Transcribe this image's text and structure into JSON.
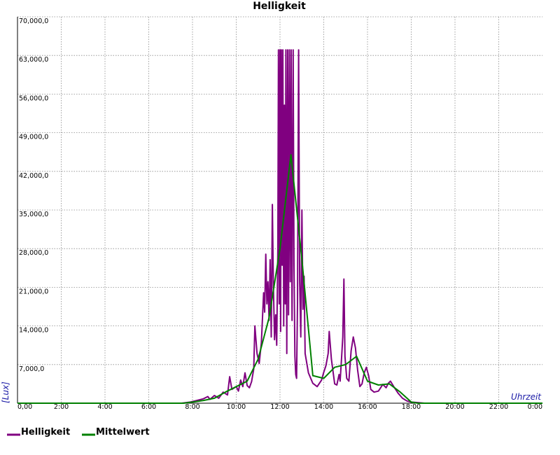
{
  "chart_data": {
    "type": "line",
    "title": "Helligkeit",
    "xlabel": "Uhrzeit",
    "ylabel": "[Lux]",
    "xlim": [
      0,
      24
    ],
    "ylim": [
      0,
      70000
    ],
    "grid": true,
    "legend_position": "bottom-left",
    "x_ticks": [
      {
        "value": 0,
        "label": "0,00"
      },
      {
        "value": 2,
        "label": "2:00"
      },
      {
        "value": 4,
        "label": "4:00"
      },
      {
        "value": 6,
        "label": "6:00"
      },
      {
        "value": 8,
        "label": "8:00"
      },
      {
        "value": 10,
        "label": "10:00"
      },
      {
        "value": 12,
        "label": "12:00"
      },
      {
        "value": 14,
        "label": "14:00"
      },
      {
        "value": 16,
        "label": "16:00"
      },
      {
        "value": 18,
        "label": "18:00"
      },
      {
        "value": 20,
        "label": "20:00"
      },
      {
        "value": 22,
        "label": "22:00"
      },
      {
        "value": 24,
        "label": "0:00"
      }
    ],
    "y_ticks": [
      {
        "value": 7000,
        "label": "7,000,0"
      },
      {
        "value": 14000,
        "label": "14,000,0"
      },
      {
        "value": 21000,
        "label": "21,000,0"
      },
      {
        "value": 28000,
        "label": "28,000,0"
      },
      {
        "value": 35000,
        "label": "35,000,0"
      },
      {
        "value": 42000,
        "label": "42,000,0"
      },
      {
        "value": 49000,
        "label": "49,000,0"
      },
      {
        "value": 56000,
        "label": "56,000,0"
      },
      {
        "value": 63000,
        "label": "63,000,0"
      },
      {
        "value": 70000,
        "label": "70,000,0"
      }
    ],
    "series": [
      {
        "name": "Helligkeit",
        "color": "#800080",
        "points": [
          [
            0,
            0
          ],
          [
            7.5,
            0
          ],
          [
            7.9,
            200
          ],
          [
            8.2,
            500
          ],
          [
            8.5,
            800
          ],
          [
            8.7,
            1200
          ],
          [
            8.8,
            700
          ],
          [
            9.0,
            1400
          ],
          [
            9.2,
            900
          ],
          [
            9.4,
            2000
          ],
          [
            9.6,
            1500
          ],
          [
            9.7,
            4800
          ],
          [
            9.8,
            2500
          ],
          [
            10.0,
            3000
          ],
          [
            10.1,
            2200
          ],
          [
            10.2,
            4200
          ],
          [
            10.3,
            3000
          ],
          [
            10.4,
            5500
          ],
          [
            10.5,
            3200
          ],
          [
            10.6,
            2800
          ],
          [
            10.7,
            3900
          ],
          [
            10.8,
            6200
          ],
          [
            10.85,
            14000
          ],
          [
            10.95,
            9000
          ],
          [
            11.05,
            7200
          ],
          [
            11.15,
            11000
          ],
          [
            11.25,
            20000
          ],
          [
            11.3,
            16500
          ],
          [
            11.35,
            27000
          ],
          [
            11.4,
            18000
          ],
          [
            11.45,
            22000
          ],
          [
            11.5,
            15000
          ],
          [
            11.55,
            26000
          ],
          [
            11.6,
            12000
          ],
          [
            11.65,
            36000
          ],
          [
            11.7,
            21000
          ],
          [
            11.75,
            11500
          ],
          [
            11.8,
            16000
          ],
          [
            11.85,
            10500
          ],
          [
            11.9,
            28000
          ],
          [
            11.93,
            64000
          ],
          [
            11.96,
            18000
          ],
          [
            12.0,
            64000
          ],
          [
            12.03,
            13000
          ],
          [
            12.06,
            64000
          ],
          [
            12.1,
            25000
          ],
          [
            12.13,
            64000
          ],
          [
            12.17,
            14000
          ],
          [
            12.2,
            54000
          ],
          [
            12.24,
            18000
          ],
          [
            12.27,
            64000
          ],
          [
            12.31,
            9000
          ],
          [
            12.35,
            64000
          ],
          [
            12.39,
            16000
          ],
          [
            12.43,
            64000
          ],
          [
            12.47,
            22000
          ],
          [
            12.51,
            64000
          ],
          [
            12.55,
            15000
          ],
          [
            12.6,
            64000
          ],
          [
            12.64,
            25000
          ],
          [
            12.68,
            8500
          ],
          [
            12.72,
            5200
          ],
          [
            12.76,
            4500
          ],
          [
            12.8,
            18000
          ],
          [
            12.85,
            64000
          ],
          [
            12.9,
            22000
          ],
          [
            12.95,
            12000
          ],
          [
            13.0,
            35000
          ],
          [
            13.05,
            17000
          ],
          [
            13.1,
            23000
          ],
          [
            13.15,
            9000
          ],
          [
            13.3,
            5500
          ],
          [
            13.5,
            3600
          ],
          [
            13.7,
            3000
          ],
          [
            13.9,
            4200
          ],
          [
            14.0,
            5600
          ],
          [
            14.1,
            6800
          ],
          [
            14.2,
            9000
          ],
          [
            14.25,
            13000
          ],
          [
            14.35,
            8000
          ],
          [
            14.5,
            3500
          ],
          [
            14.6,
            3300
          ],
          [
            14.7,
            5200
          ],
          [
            14.75,
            4000
          ],
          [
            14.82,
            8500
          ],
          [
            14.87,
            12000
          ],
          [
            14.92,
            22500
          ],
          [
            14.97,
            8500
          ],
          [
            15.05,
            4500
          ],
          [
            15.15,
            4000
          ],
          [
            15.25,
            9500
          ],
          [
            15.35,
            12000
          ],
          [
            15.45,
            10000
          ],
          [
            15.55,
            6000
          ],
          [
            15.65,
            3000
          ],
          [
            15.75,
            3500
          ],
          [
            15.85,
            5500
          ],
          [
            15.95,
            6500
          ],
          [
            16.05,
            5000
          ],
          [
            16.15,
            2500
          ],
          [
            16.3,
            2000
          ],
          [
            16.5,
            2200
          ],
          [
            16.7,
            3400
          ],
          [
            16.85,
            2800
          ],
          [
            16.95,
            3600
          ],
          [
            17.05,
            4000
          ],
          [
            17.2,
            3000
          ],
          [
            17.4,
            1800
          ],
          [
            17.6,
            900
          ],
          [
            17.8,
            400
          ],
          [
            18.0,
            200
          ],
          [
            18.3,
            120
          ],
          [
            18.6,
            0
          ],
          [
            24,
            0
          ]
        ]
      },
      {
        "name": "Mittelwert",
        "color": "#008000",
        "points": [
          [
            0,
            0
          ],
          [
            7.6,
            0
          ],
          [
            8.0,
            200
          ],
          [
            8.5,
            500
          ],
          [
            9.0,
            900
          ],
          [
            9.5,
            2000
          ],
          [
            10.0,
            3000
          ],
          [
            10.5,
            4000
          ],
          [
            11.0,
            8000
          ],
          [
            11.5,
            15500
          ],
          [
            12.0,
            28000
          ],
          [
            12.5,
            45000
          ],
          [
            13.0,
            26000
          ],
          [
            13.5,
            5000
          ],
          [
            14.0,
            4500
          ],
          [
            14.5,
            6500
          ],
          [
            15.0,
            7000
          ],
          [
            15.5,
            8500
          ],
          [
            16.0,
            4000
          ],
          [
            16.5,
            3300
          ],
          [
            17.0,
            3500
          ],
          [
            17.5,
            2000
          ],
          [
            18.0,
            200
          ],
          [
            18.3,
            0
          ],
          [
            24,
            0
          ]
        ]
      }
    ]
  }
}
